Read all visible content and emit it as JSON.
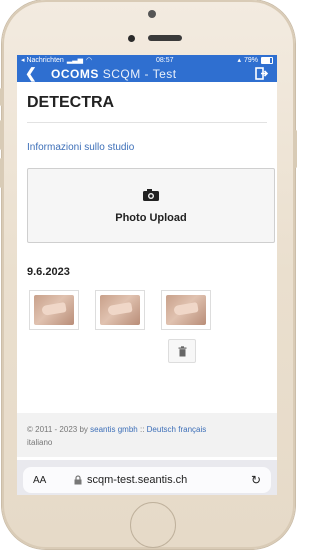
{
  "status": {
    "carrier": "◂ Nachrichten",
    "time": "08:57",
    "battery": "79%"
  },
  "app": {
    "back_glyph": "❮",
    "title_bold": "OCOMS",
    "title_rest": "SCQM - Test"
  },
  "page": {
    "title": "DETECTRA",
    "study_link": "Informazioni sullo studio",
    "upload_label": "Photo Upload",
    "date": "9.6.2023"
  },
  "footer": {
    "copyright": "© 2011 - 2023 by",
    "company": "seantis gmbh",
    "sep": "::",
    "lang1": "Deutsch",
    "lang2": "français",
    "lang3": "italiano"
  },
  "browser": {
    "aa": "AA",
    "url": "scqm-test.seantis.ch",
    "reload": "↻"
  },
  "colors": {
    "accent": "#2f6fd0",
    "link": "#3d6fb8"
  },
  "icons": {
    "camera": "camera-icon",
    "trash": "trash-icon",
    "logout": "logout-icon",
    "lock": "lock-icon"
  }
}
